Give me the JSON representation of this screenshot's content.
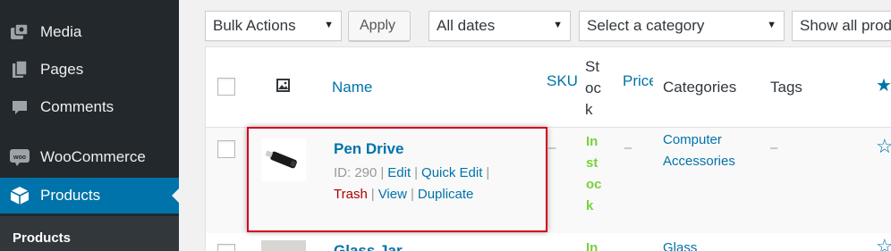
{
  "sidebar": {
    "items": [
      {
        "label": "Media",
        "icon": "media-icon"
      },
      {
        "label": "Pages",
        "icon": "pages-icon"
      },
      {
        "label": "Comments",
        "icon": "comments-icon"
      },
      {
        "label": "WooCommerce",
        "icon": "woocommerce-icon"
      },
      {
        "label": "Products",
        "icon": "products-icon"
      }
    ],
    "submenu_current": "Products",
    "colors": {
      "background": "#23282d",
      "active": "#0073aa"
    }
  },
  "filters": {
    "bulk_actions": "Bulk Actions",
    "apply": "Apply",
    "dates": "All dates",
    "category": "Select a category",
    "stock": "Show all prod"
  },
  "table": {
    "headers": {
      "name": "Name",
      "sku": "SKU",
      "stock": "Stock",
      "price": "Price",
      "categories": "Categories",
      "tags": "Tags"
    },
    "rows": [
      {
        "name": "Pen Drive",
        "id_text": "ID: 290",
        "actions": {
          "edit": "Edit",
          "quick_edit": "Quick Edit",
          "trash": "Trash",
          "view": "View",
          "duplicate": "Duplicate"
        },
        "sku": "–",
        "stock": "In stock",
        "price": "–",
        "categories": [
          "Computer",
          "Accessories"
        ],
        "tags": "–"
      },
      {
        "name": "Glass Jar",
        "stock": "In",
        "categories": "Glass"
      }
    ]
  },
  "colors": {
    "link": "#0073aa",
    "instock": "#7ad03a",
    "trash": "#a00",
    "highlight": "#d0021b"
  }
}
